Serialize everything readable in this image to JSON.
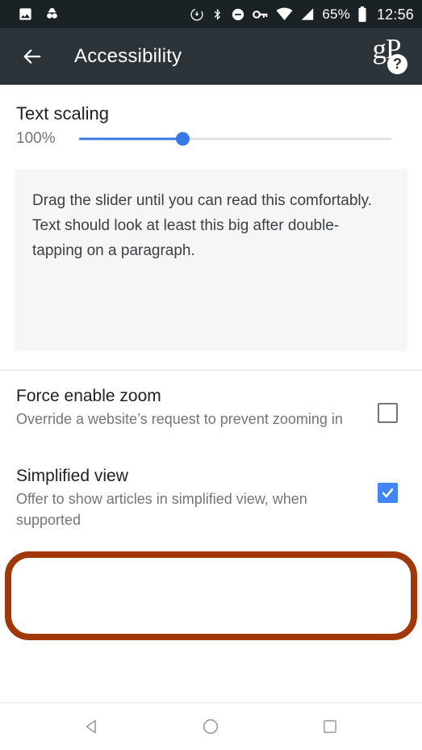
{
  "statusbar": {
    "left_icons": [
      "image-icon",
      "incognito-icon"
    ],
    "right_icons": [
      "download-circle-icon",
      "bluetooth-icon",
      "do-not-disturb-icon",
      "vpn-key-icon",
      "wifi-icon",
      "cell-signal-icon"
    ],
    "battery_percent": "65%",
    "battery_icon": "battery-icon",
    "clock": "12:56",
    "background": "#1b2226"
  },
  "appbar": {
    "back_icon": "back-arrow-icon",
    "title": "Accessibility",
    "logo_text": "gP",
    "help_badge": "?",
    "background": "#2c3439"
  },
  "text_scaling": {
    "title": "Text scaling",
    "value_label": "100%",
    "slider_percent": 33,
    "accent_color": "#3b78e7",
    "preview_text": "Drag the slider until you can read this comfortably. Text should look at least this big after double-tapping on a paragraph."
  },
  "preferences": [
    {
      "title": "Force enable zoom",
      "summary": "Override a website’s request to prevent zooming in",
      "checked": false
    },
    {
      "title": "Simplified view",
      "summary": "Offer to show articles in simplified view, when supported",
      "checked": true
    }
  ],
  "highlight": {
    "color": "#a0380a",
    "target": "Simplified view"
  },
  "checkbox_checked_color": "#4285f4",
  "navbar": {
    "back_label": "back-triangle-icon",
    "home_label": "home-circle-icon",
    "recents_label": "recents-square-icon"
  }
}
